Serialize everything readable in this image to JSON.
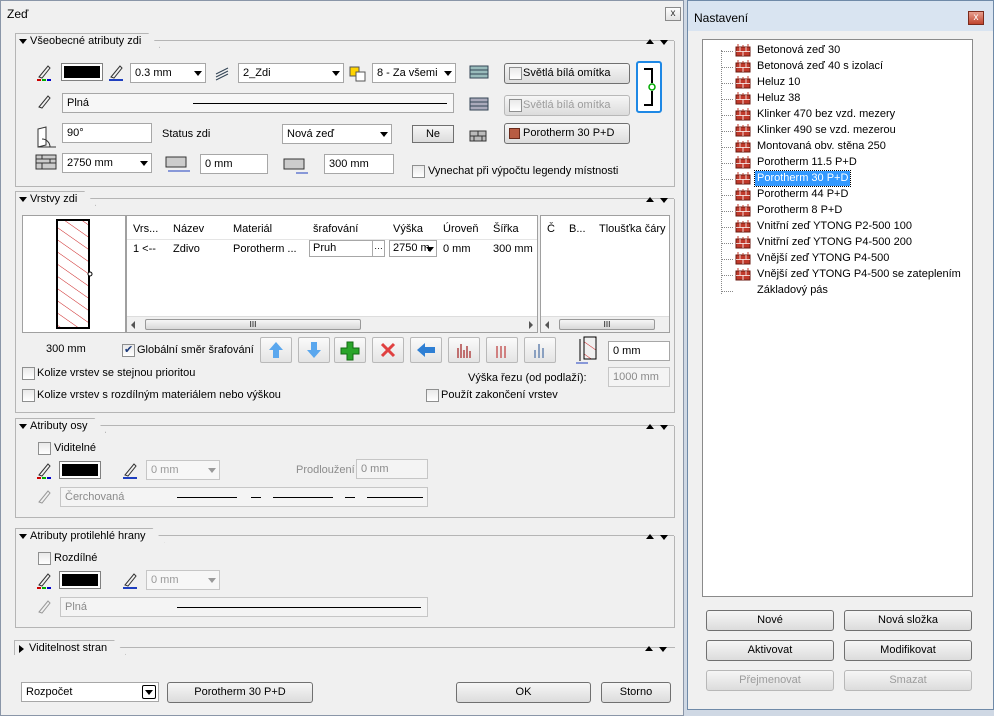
{
  "main_window": {
    "title": "Zeď",
    "close": "x"
  },
  "general": {
    "header": "Všeobecné atributy zdi",
    "line_width": "0.3 mm",
    "layer": "2_Zdi",
    "priority": "8 - Za všemi",
    "plaster1": "Světlá bílá omítka",
    "plaster2": "Světlá bílá omítka",
    "line_style": "Plná",
    "angle": "90°",
    "status_label": "Status zdi",
    "status_value": "Nová zeď",
    "ne_button": "Ne",
    "material_button": "Porotherm 30 P+D",
    "height": "2750 mm",
    "offset": "0 mm",
    "thickness": "300 mm",
    "omit_legend": "Vynechat při výpočtu legendy místnosti"
  },
  "layers": {
    "header": "Vrstvy zdi",
    "columns": [
      "Vrs...",
      "Název",
      "Materiál",
      "šrafování",
      "Výška",
      "Úroveň",
      "Šířka"
    ],
    "row": {
      "vrs": "1 <--",
      "nazev": "Zdivo",
      "material": "Porotherm ...",
      "srafovani": "Pruh",
      "vyska": "2750 m",
      "uroven": "0 mm",
      "sirka": "300 mm"
    },
    "right_columns": [
      "Č",
      "B...",
      "Tloušťka čáry"
    ],
    "scroll_mark": "III",
    "preview_width": "300 mm",
    "global_hatch": "Globální směr šrafování",
    "collide_same": "Kolize vrstev se stejnou prioritou",
    "collide_diff": "Kolize vrstev s rozdílným materiálem nebo výškou",
    "cut_height_label": "Výška řezu (od podlaží):",
    "cut_height": "1000 mm",
    "offset_value": "0 mm",
    "use_end": "Použít zakončení vrstev"
  },
  "axis": {
    "header": "Atributy osy",
    "visible": "Viditelné",
    "width": "0 mm",
    "extension_label": "Prodloužení",
    "extension": "0 mm",
    "style": "Čerchovaná"
  },
  "opposite": {
    "header": "Atributy protilehlé hrany",
    "different": "Rozdílné",
    "width": "0 mm",
    "style": "Plná"
  },
  "visibility": {
    "header": "Viditelnost stran"
  },
  "footer": {
    "budget": "Rozpočet",
    "material": "Porotherm 30 P+D",
    "ok": "OK",
    "cancel": "Storno"
  },
  "settings_window": {
    "title": "Nastavení",
    "close": "x",
    "items": [
      "Betonová zeď 30",
      "Betonová zeď 40 s izolací",
      "Heluz 10",
      "Heluz 38",
      "Klinker 470 bez vzd. mezery",
      "Klinker 490 se vzd. mezerou",
      "Montovaná obv. stěna 250",
      "Porotherm 11.5 P+D",
      "Porotherm 30 P+D",
      "Porotherm 44 P+D",
      "Porotherm 8 P+D",
      "Vnitřní zeď YTONG P2-500 100",
      "Vnitřní zeď YTONG P4-500 200",
      "Vnější zeď YTONG P4-500",
      "Vnější zeď YTONG P4-500 se zateplením",
      "Základový pás"
    ],
    "selected_index": 8,
    "new": "Nové",
    "new_folder": "Nová složka",
    "activate": "Aktivovat",
    "modify": "Modifikovat",
    "rename": "Přejmenovat",
    "delete": "Smazat"
  },
  "colors": {
    "selection": "#3399ff",
    "hatch": "#cc2222",
    "brick": "#c0392b"
  }
}
